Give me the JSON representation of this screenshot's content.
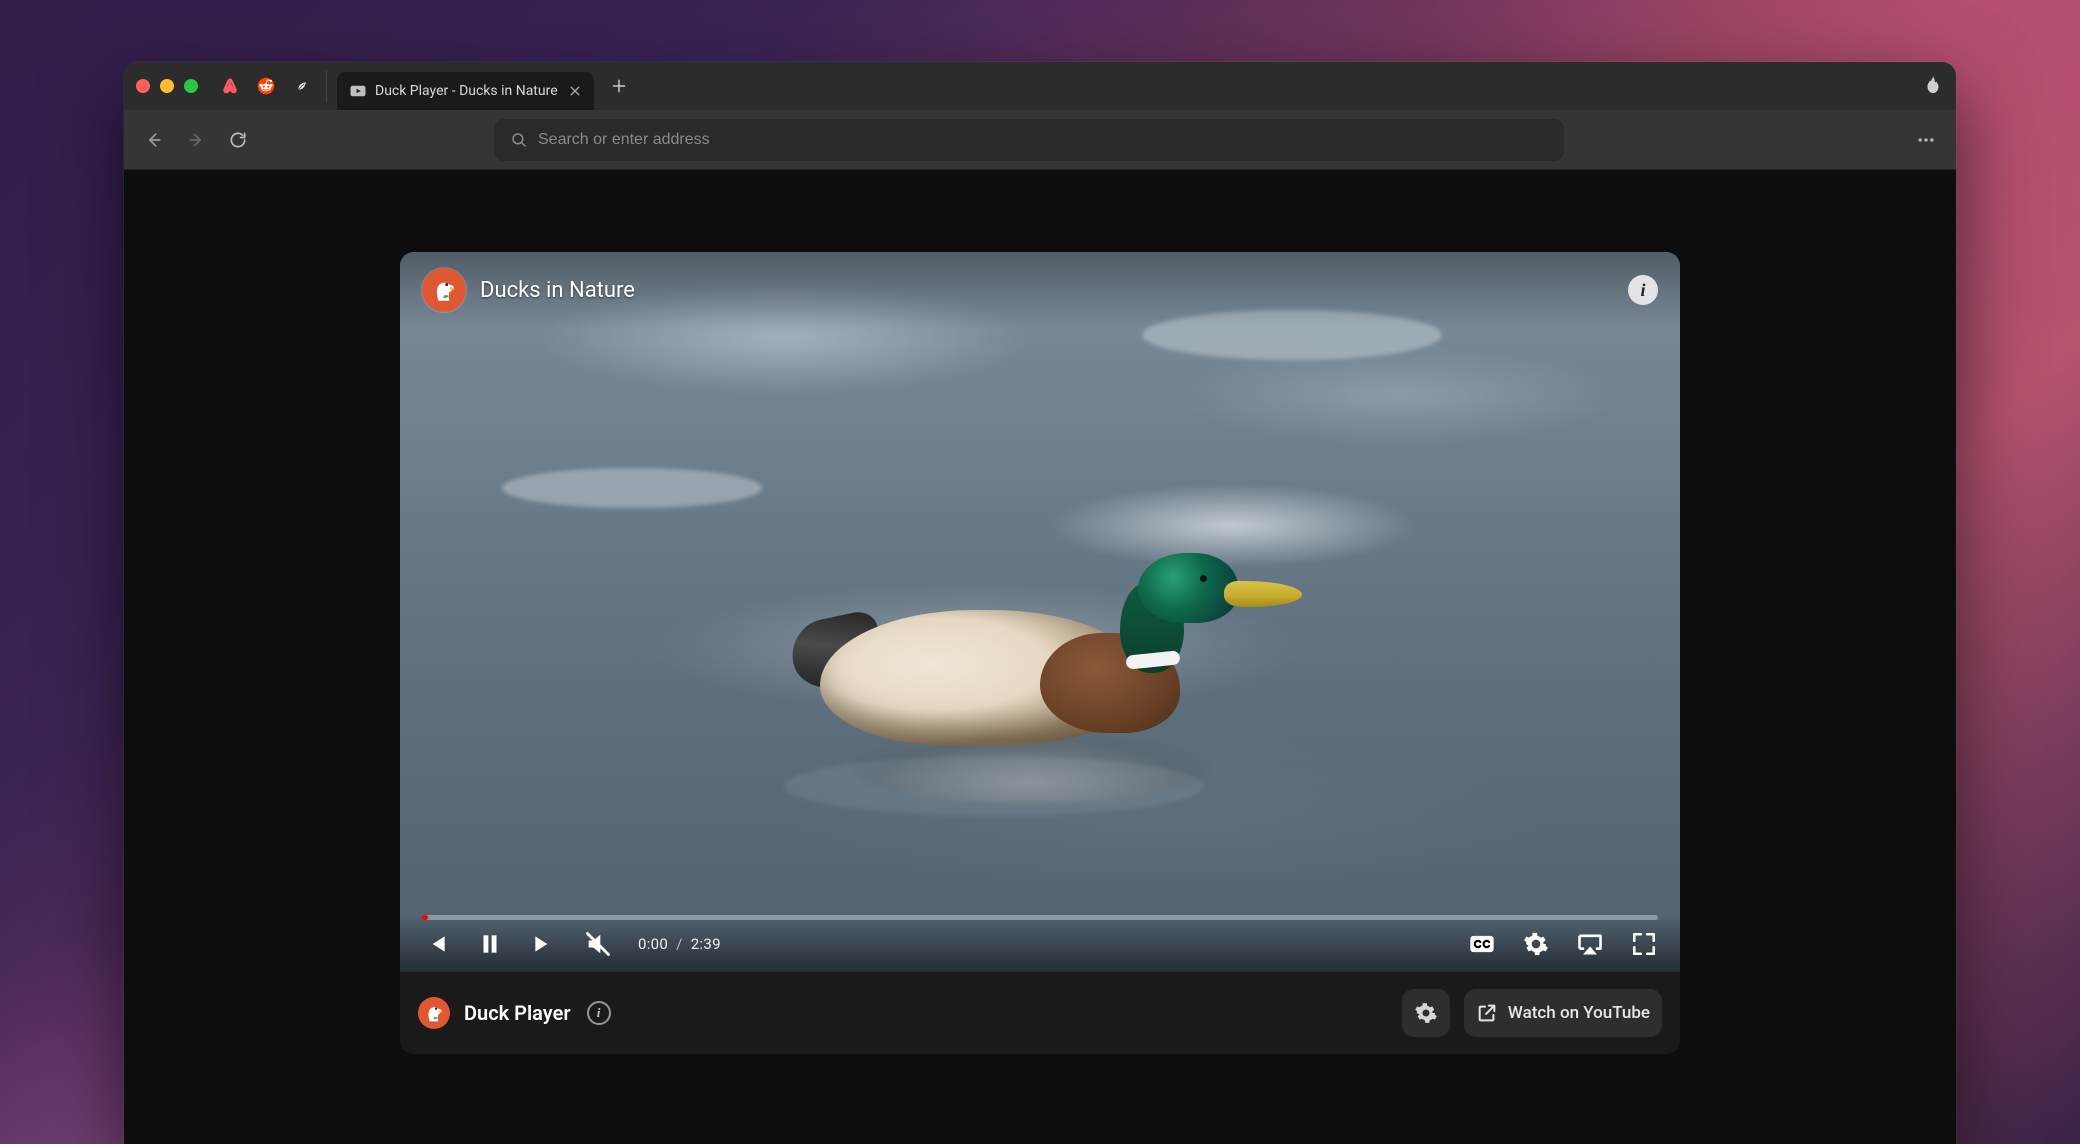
{
  "tab": {
    "title": "Duck Player - Ducks in Nature"
  },
  "toolbar": {
    "search_placeholder": "Search or enter address"
  },
  "pinned": [
    {
      "name": "airbnb"
    },
    {
      "name": "reddit"
    },
    {
      "name": "notes"
    }
  ],
  "video": {
    "title": "Ducks in Nature",
    "current_time": "0:00",
    "time_separator": "/",
    "duration": "2:39",
    "progress_percent": 0.5
  },
  "below": {
    "player_name": "Duck Player",
    "watch_label": "Watch on YouTube"
  }
}
